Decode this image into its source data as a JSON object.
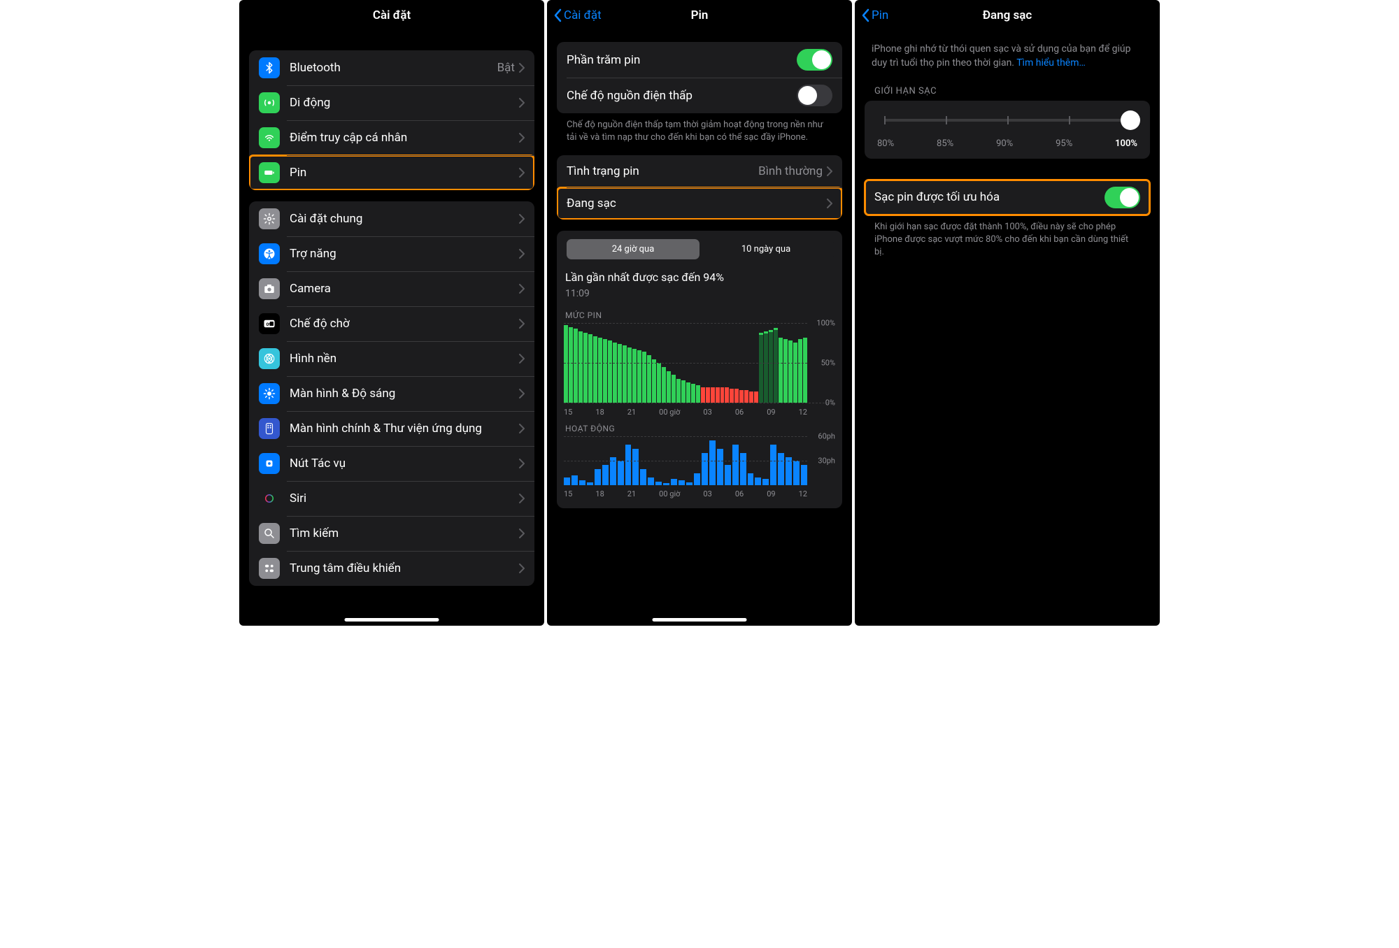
{
  "screen1": {
    "title": "Cài đặt",
    "group1": [
      {
        "icon": "bluetooth",
        "color": "#007aff",
        "label": "Bluetooth",
        "value": "Bật"
      },
      {
        "icon": "cellular",
        "color": "#30d158",
        "label": "Di động"
      },
      {
        "icon": "hotspot",
        "color": "#30d158",
        "label": "Điểm truy cập cá nhân"
      },
      {
        "icon": "battery",
        "color": "#30d158",
        "label": "Pin",
        "highlight": true
      }
    ],
    "group2": [
      {
        "icon": "gear",
        "color": "#8e8e93",
        "label": "Cài đặt chung"
      },
      {
        "icon": "accessibility",
        "color": "#007aff",
        "label": "Trợ năng"
      },
      {
        "icon": "camera",
        "color": "#8e8e93",
        "label": "Camera"
      },
      {
        "icon": "standby",
        "color": "#000",
        "label": "Chế độ chờ"
      },
      {
        "icon": "wallpaper",
        "color": "#35c4dc",
        "label": "Hình nền"
      },
      {
        "icon": "display",
        "color": "#007aff",
        "label": "Màn hình & Độ sáng"
      },
      {
        "icon": "homescreen",
        "color": "#3357ce",
        "label": "Màn hình chính & Thư viện ứng dụng"
      },
      {
        "icon": "action",
        "color": "#007aff",
        "label": "Nút Tác vụ"
      },
      {
        "icon": "siri",
        "color": "#1c1c1e",
        "label": "Siri"
      },
      {
        "icon": "search",
        "color": "#8e8e93",
        "label": "Tìm kiếm"
      },
      {
        "icon": "control",
        "color": "#8e8e93",
        "label": "Trung tâm điều khiển"
      }
    ]
  },
  "screen2": {
    "back": "Cài đặt",
    "title": "Pin",
    "percentage": {
      "label": "Phần trăm pin",
      "on": true
    },
    "lowpower": {
      "label": "Chế độ nguồn điện thấp",
      "on": false
    },
    "lowpower_footer": "Chế độ nguồn điện thấp tạm thời giảm hoạt động trong nền như tải về và tìm nạp thư cho đến khi bạn có thể sạc đầy iPhone.",
    "health": {
      "label": "Tình trạng pin",
      "value": "Bình thường"
    },
    "charging": {
      "label": "Đang sạc",
      "highlight": true
    },
    "tabs": {
      "a": "24 giờ qua",
      "b": "10 ngày qua"
    },
    "last_charge": "Lần gần nhất được sạc đến 94%",
    "last_charge_time": "11:09",
    "level_label": "MỨC PIN",
    "activity_label": "HOẠT ĐỘNG",
    "xticks": [
      "15",
      "18",
      "21",
      "00 giờ",
      "03",
      "06",
      "09",
      "12"
    ],
    "ypct": [
      "100%",
      "50%",
      "0%"
    ],
    "ymin": [
      "60ph",
      "30ph"
    ]
  },
  "screen3": {
    "back": "Pin",
    "title": "Đang sạc",
    "intro": "iPhone ghi nhớ từ thói quen sạc và sử dụng của bạn để giúp duy trì tuổi thọ pin theo thời gian. ",
    "intro_link": "Tìm hiểu thêm…",
    "limit_header": "GIỚI HẠN SẠC",
    "limit_values": [
      "80%",
      "85%",
      "90%",
      "95%",
      "100%"
    ],
    "optimized": {
      "label": "Sạc pin được tối ưu hóa",
      "on": true,
      "highlight": true
    },
    "optimized_footer": "Khi giới hạn sạc được đặt thành 100%, điều này sẽ cho phép iPhone được sạc vượt mức 80% cho đến khi bạn cần dùng thiết bị."
  },
  "chart_data": {
    "type": "bar",
    "battery_level": {
      "xlabel": "",
      "ylabel": "MỨC PIN",
      "ylim": [
        0,
        100
      ],
      "x_ticks": [
        "15",
        "18",
        "21",
        "00 giờ",
        "03",
        "06",
        "09",
        "12"
      ],
      "y_ticks": [
        "0%",
        "50%",
        "100%"
      ],
      "values": [
        98,
        95,
        93,
        90,
        88,
        86,
        84,
        82,
        80,
        78,
        76,
        74,
        72,
        70,
        68,
        66,
        64,
        60,
        55,
        50,
        45,
        40,
        35,
        30,
        28,
        26,
        24,
        22,
        20,
        20,
        20,
        20,
        20,
        20,
        18,
        18,
        16,
        16,
        14,
        14,
        88,
        90,
        92,
        94,
        82,
        80,
        78,
        76,
        80,
        82
      ],
      "low_threshold": 20,
      "charging_indices": [
        40,
        41,
        42,
        43
      ]
    },
    "activity": {
      "xlabel": "",
      "ylabel": "HOẠT ĐỘNG",
      "ylim": [
        0,
        60
      ],
      "unit": "ph",
      "x_ticks": [
        "15",
        "18",
        "21",
        "00 giờ",
        "03",
        "06",
        "09",
        "12"
      ],
      "y_ticks": [
        "30ph",
        "60ph"
      ],
      "values": [
        10,
        12,
        6,
        4,
        20,
        25,
        35,
        30,
        50,
        45,
        20,
        10,
        5,
        3,
        8,
        6,
        4,
        15,
        40,
        55,
        45,
        25,
        50,
        40,
        15,
        10,
        8,
        50,
        40,
        35,
        30,
        25
      ]
    }
  }
}
